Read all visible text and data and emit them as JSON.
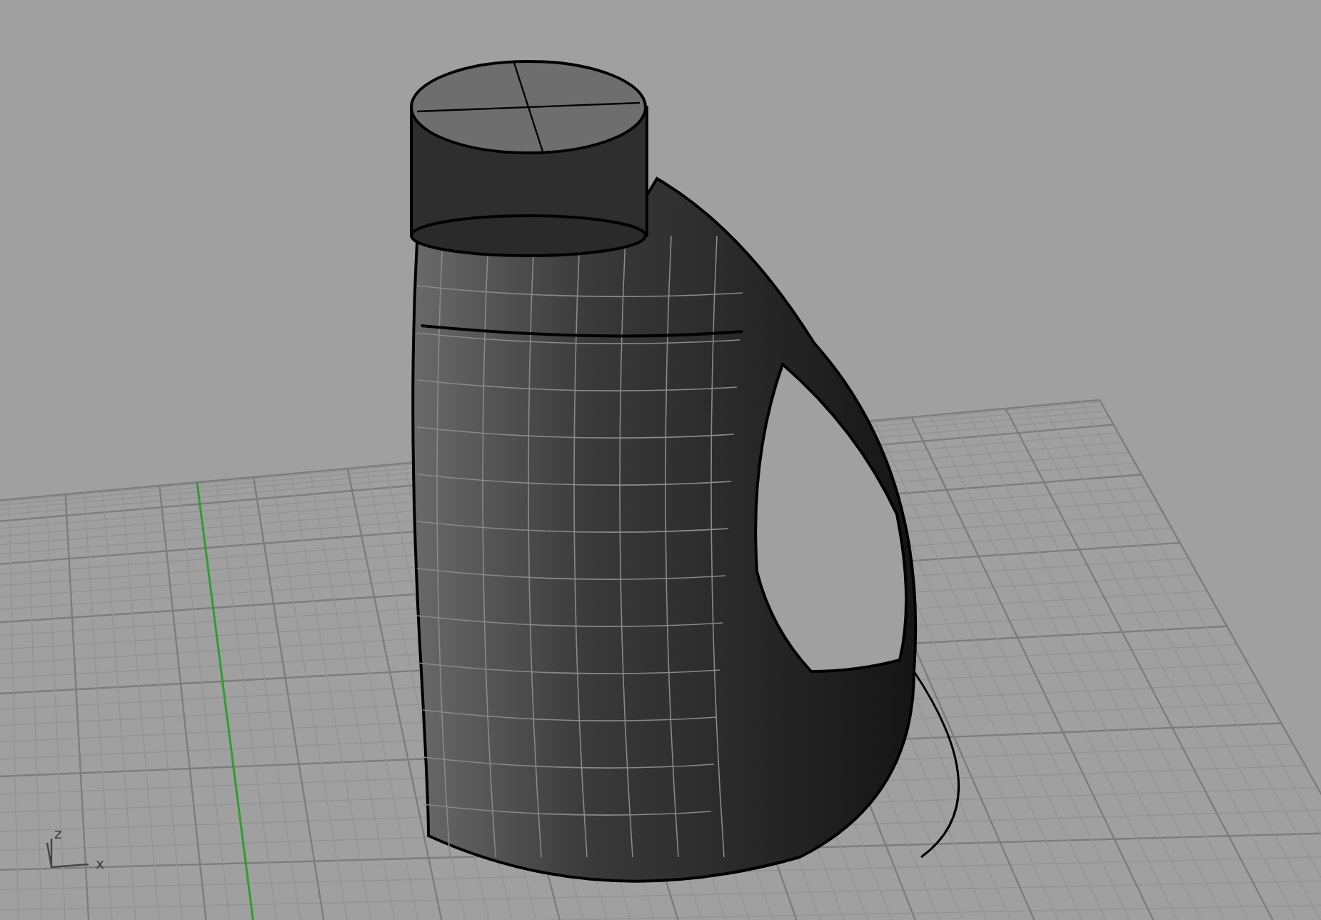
{
  "viewport": {
    "axis_labels": [
      {
        "text": "z",
        "kind": "z"
      },
      {
        "text": "x",
        "kind": "x"
      }
    ]
  }
}
